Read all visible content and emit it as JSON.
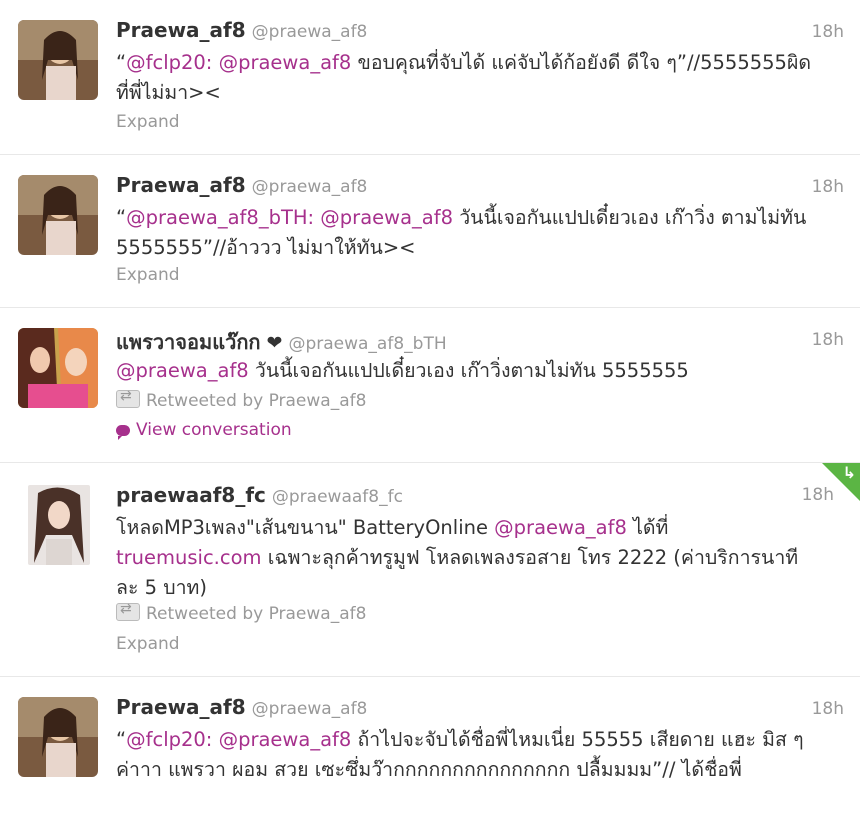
{
  "tweets": [
    {
      "name": "Praewa_af8",
      "handle": "@praewa_af8",
      "time": "18h",
      "text_parts": [
        "“",
        "@fclp20:",
        " ",
        "@praewa_af8",
        " ขอบคุณที่จับได้ แค่จับได้ก้อยังดี ดีใจ ๆ”//5555555ผิดที่พี่ไม่มา><"
      ],
      "action": "Expand"
    },
    {
      "name": "Praewa_af8",
      "handle": "@praewa_af8",
      "time": "18h",
      "text_parts": [
        "“",
        "@praewa_af8_bTH:",
        " ",
        "@praewa_af8",
        " วันนี้เจอกันแปปเดี๋ยวเอง เก๊าวิ่ง ตามไม่ทัน 5555555”//อ้าววว ไม่มาให้ทัน><"
      ],
      "action": "Expand"
    },
    {
      "name": "แพรวาจอมแว๊กก",
      "heart": "❤",
      "handle": "@praewa_af8_bTH",
      "time": "18h",
      "text_parts": [
        "@praewa_af8",
        " วันนี้เจอกันแปปเดี๋ยวเอง เก๊าวิ่งตามไม่ทัน 5555555"
      ],
      "retweeted": "Retweeted by Praewa_af8",
      "action": "View conversation"
    },
    {
      "name": "praewaaf8_fc",
      "handle": "@praewaaf8_fc",
      "time": "18h",
      "text_parts": [
        "โหลดMP3เพลง\"เส้นขนาน\" BatteryOnline ",
        "@praewa_af8",
        " ได้ที่ ",
        "truemusic.com",
        " เฉพาะลุกค้าทรูมูฟ โหลดเพลงรอสาย โทร 2222 (ค่าบริการนาทีละ 5 บาท)"
      ],
      "retweeted": "Retweeted by Praewa_af8",
      "action": "Expand"
    },
    {
      "name": "Praewa_af8",
      "handle": "@praewa_af8",
      "time": "18h",
      "text_parts": [
        "“",
        "@fclp20:",
        " ",
        "@praewa_af8",
        " ถ้าไปจะจับได้ชื่อพี่ไหมเนี่ย 55555 เสียดาย แฮะ มิส ๆ ค่าาา แพรวา ผอม สวย เซะซึ่มว๊ากกกกกกกกกกกกกกก ปลื้มมมม”// ได้ชื่อพี่"
      ]
    }
  ],
  "colors": {
    "link": "#a6308c",
    "muted": "#999999",
    "corner": "#5bb544"
  }
}
